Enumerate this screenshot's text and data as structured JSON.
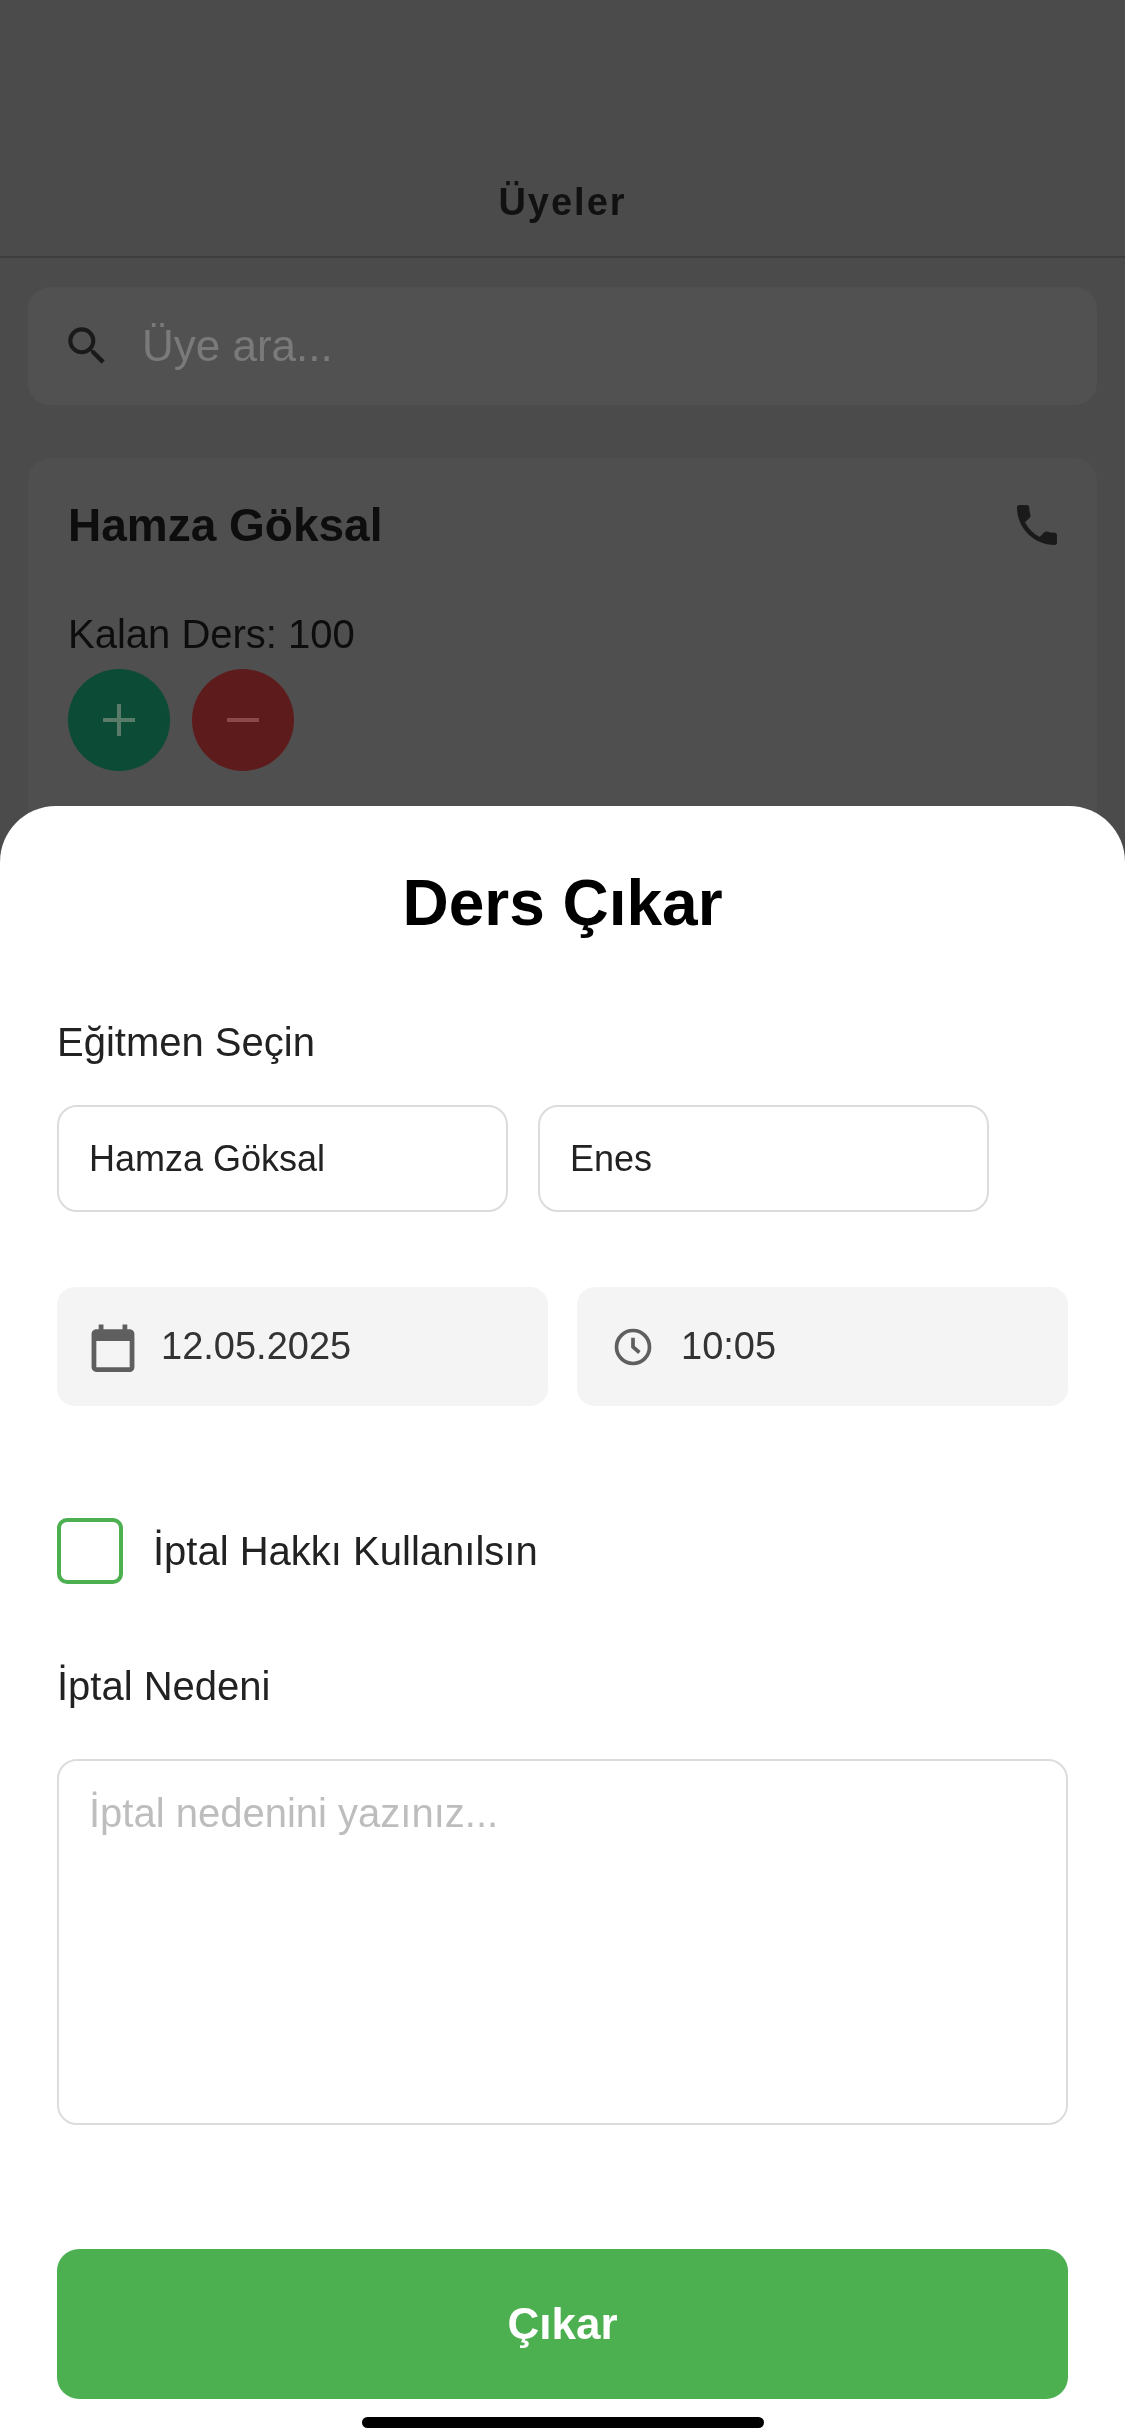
{
  "header": {
    "title": "Üyeler"
  },
  "search": {
    "placeholder": "Üye ara..."
  },
  "members": [
    {
      "name": "Hamza Göksal",
      "remaining": "Kalan Ders: 100"
    }
  ],
  "sheet": {
    "title": "Ders Çıkar",
    "instructor_label": "Eğitmen Seçin",
    "instructors": [
      {
        "name": "Hamza Göksal",
        "selected": false
      },
      {
        "name": "Enes",
        "selected": false
      }
    ],
    "date": "12.05.2025",
    "time": "10:05",
    "cancel_right": {
      "label": "İptal Hakkı Kullanılsın",
      "checked": false
    },
    "reason_label": "İptal Nedeni",
    "reason": {
      "placeholder": "İptal nedenini yazınız..."
    },
    "submit": "Çıkar"
  }
}
